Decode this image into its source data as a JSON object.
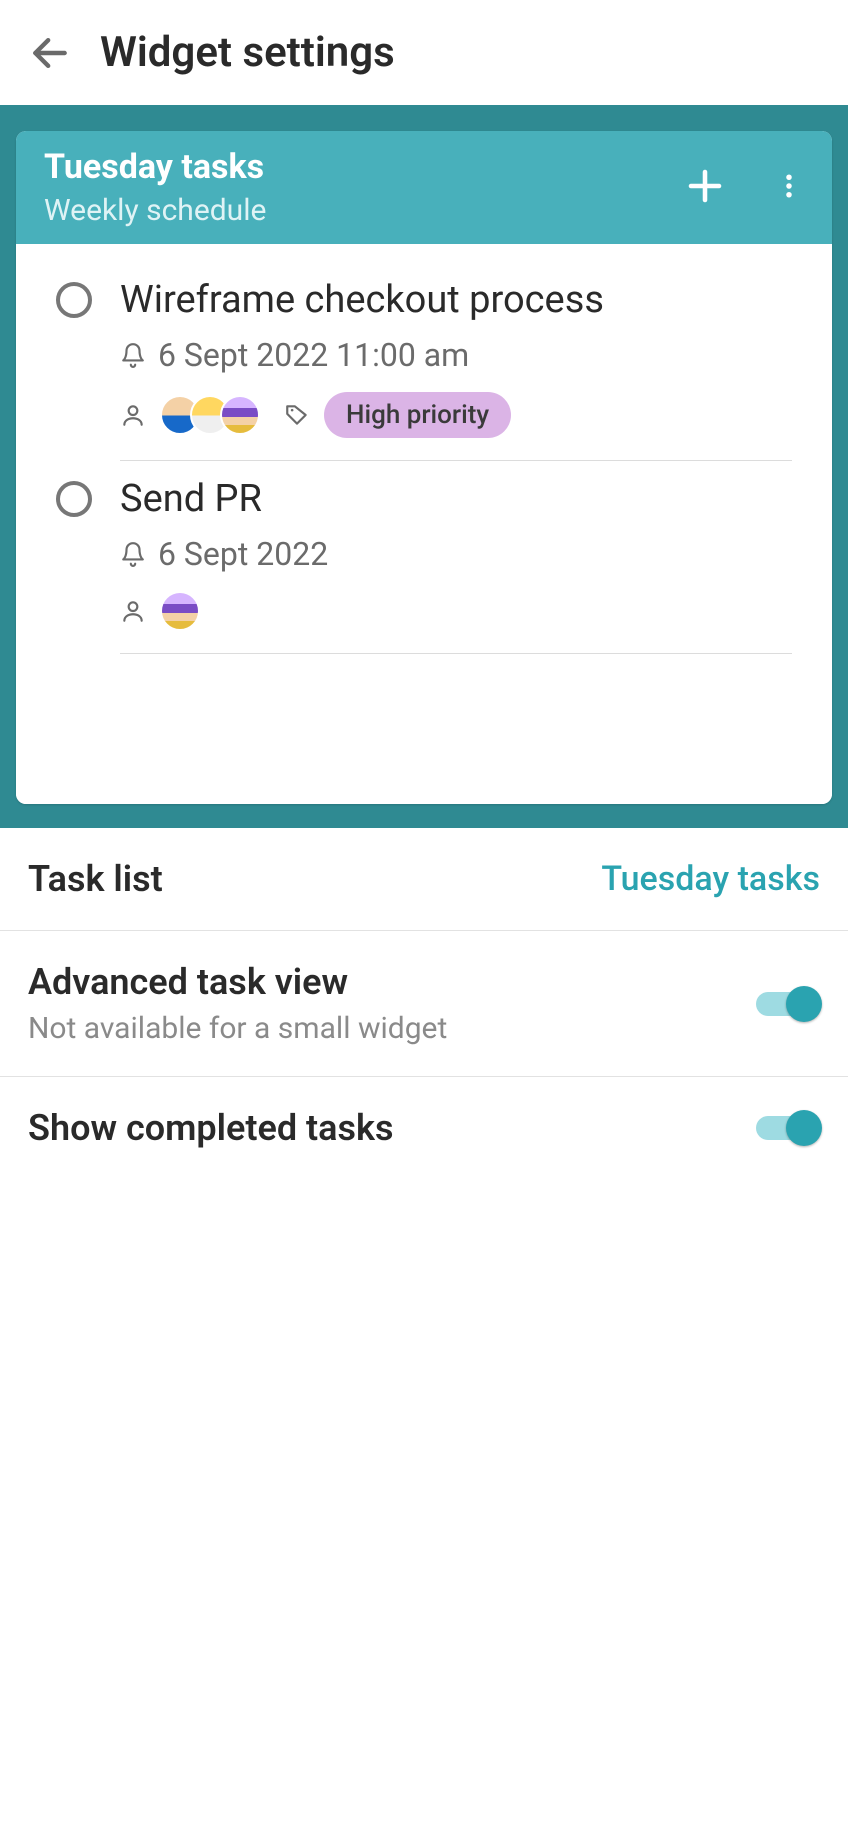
{
  "header": {
    "title": "Widget settings"
  },
  "widget": {
    "title": "Tuesday tasks",
    "subtitle": "Weekly schedule"
  },
  "tasks": [
    {
      "title": "Wireframe checkout process",
      "datetime": "6 Sept 2022 11:00 am",
      "assignees": [
        "a1",
        "a2",
        "a3"
      ],
      "tag": "High priority"
    },
    {
      "title": "Send PR",
      "datetime": "6 Sept 2022",
      "assignees": [
        "a3"
      ]
    }
  ],
  "settings": {
    "task_list": {
      "label": "Task list",
      "value": "Tuesday tasks"
    },
    "advanced": {
      "label": "Advanced task view",
      "sub": "Not available for a small widget",
      "on": true
    },
    "show_completed": {
      "label": "Show completed tasks",
      "on": true
    }
  },
  "colors": {
    "teal_bg": "#2f8a92",
    "teal_header": "#48b0bb",
    "accent": "#2aa3b0",
    "tag_bg": "#dbb4e6"
  }
}
